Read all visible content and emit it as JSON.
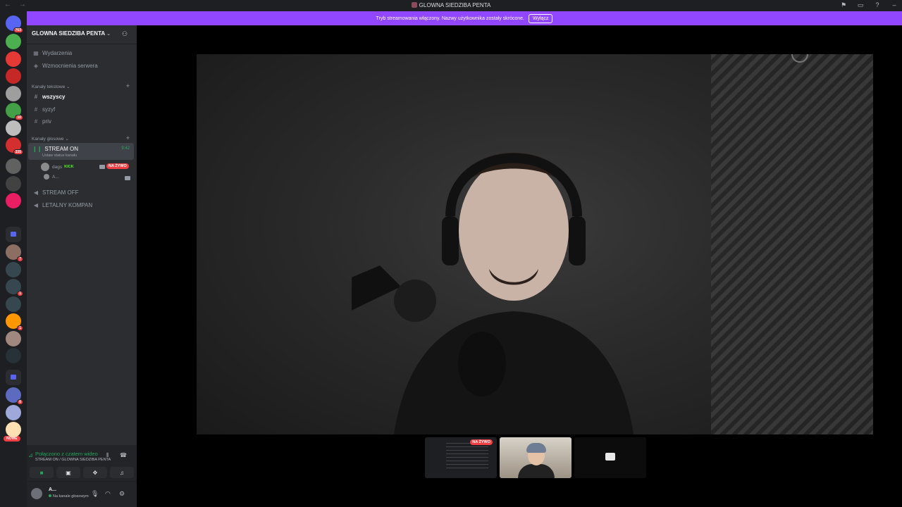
{
  "window": {
    "title": "GLOWNA SIEDZIBA PENTA",
    "nav_arrows": "← →",
    "icons": [
      "inbox-icon",
      "screen-icon",
      "help-icon",
      "minimize-icon"
    ]
  },
  "banner": {
    "text": "Tryb streamowania włączony. Nazwy użytkownika zostały skrócone.",
    "button": "Wyłącz",
    "color": "#9146ff"
  },
  "rail": {
    "home_badge": "763",
    "servers": [
      {
        "badge": "",
        "color": "#4caf50"
      },
      {
        "badge": "",
        "color": "#e53935"
      },
      {
        "badge": "",
        "color": "#c62828"
      },
      {
        "badge": "",
        "color": "#9e9e9e"
      },
      {
        "badge": "10",
        "color": "#43a047"
      },
      {
        "badge": "",
        "color": "#bdbdbd"
      },
      {
        "badge": "335",
        "color": "#d32f2f"
      },
      {
        "badge": "",
        "color": "#616161"
      },
      {
        "badge": "",
        "color": "#424242"
      },
      {
        "badge": "",
        "color": "#e91e63"
      }
    ],
    "letter_server": "G",
    "more_servers": [
      {
        "badge": "7",
        "color": "#8d6e63"
      },
      {
        "badge": "",
        "color": "#37474f"
      },
      {
        "badge": "1",
        "color": "#37474f"
      },
      {
        "badge": "",
        "color": "#37474f"
      },
      {
        "badge": "1",
        "color": "#ff9800"
      },
      {
        "badge": "",
        "color": "#a1887f"
      },
      {
        "badge": "",
        "color": "#263238"
      },
      {
        "badge": "6",
        "color": "#5c6bc0"
      },
      {
        "badge": "",
        "color": "#9fa8da"
      },
      {
        "badge": "",
        "color": "#ffe0b2"
      }
    ],
    "nowe": "NOWE"
  },
  "sidebar": {
    "guild_name": "GLOWNA SIEDZIBA PENTA",
    "events": "Wydarzenia",
    "boosts": "Wzmocnienia serwera",
    "text_category": "Kanały tekstowe",
    "text_channels": [
      "wszyscy",
      "syzyf",
      "priv"
    ],
    "voice_category": "Kanały głosowe",
    "active_voice": {
      "name": "STREAM ON",
      "status": "Ustaw status kanału",
      "time": "9:42"
    },
    "members": [
      {
        "name": "dags",
        "tag": "KICK",
        "live": "NA ŻYWO"
      },
      {
        "name": "A..."
      }
    ],
    "voice_channels": [
      "STREAM OFF",
      "LETALNY KOMPAN"
    ]
  },
  "voice_panel": {
    "connected": "Połączono z czatem wideo",
    "location": "STREAM ON / GLOWNA SIEDZIBA PENTA"
  },
  "user": {
    "name": "A...",
    "status": "Na kanale głosowym"
  },
  "stage": {
    "thumbs": [
      {
        "type": "screen",
        "label": "NA ŻYWO"
      },
      {
        "type": "camera"
      },
      {
        "type": "camera-off"
      }
    ]
  }
}
